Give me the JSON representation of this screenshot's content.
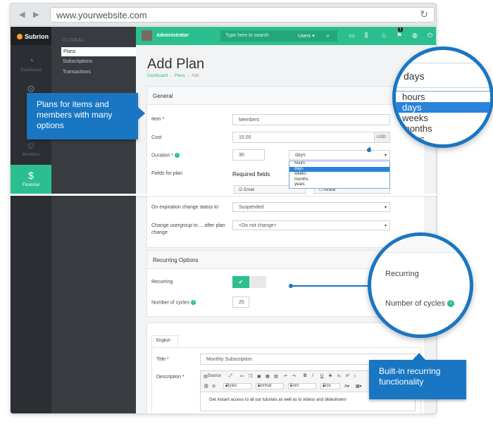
{
  "browser": {
    "url": "www.yourwebsite.com"
  },
  "app": {
    "logo": "Subrion",
    "sidebar": [
      {
        "label": "Dashboard",
        "icon": "dashboard-icon"
      },
      {
        "label": "",
        "icon": "gear-icon"
      },
      {
        "label": "",
        "icon": "content-icon"
      },
      {
        "label": "Members",
        "icon": "user-icon"
      },
      {
        "label": "Financial",
        "icon": "dollar-icon",
        "active": true
      }
    ],
    "subnav": {
      "group": "GLOBAL",
      "items": [
        "Plans",
        "Subscriptions",
        "Transactions"
      ],
      "active": "Plans"
    },
    "topbar": {
      "user": "Administrator",
      "search_placeholder": "Type here to search",
      "search_scope": "Users",
      "badge": "1"
    }
  },
  "page": {
    "title": "Add Plan",
    "breadcrumb": [
      "Dashboard",
      "Plans",
      "Add"
    ],
    "general": {
      "heading": "General",
      "item_label": "Item *",
      "item_value": "Members",
      "cost_label": "Cost",
      "cost_value": "15.00",
      "currency": "USD",
      "duration_label": "Duration *",
      "duration_value": "30",
      "duration_unit": "days",
      "duration_options": [
        "hours",
        "days",
        "weeks",
        "months",
        "years"
      ],
      "fields_label": "Fields for plan",
      "required_fields": "Required fields",
      "checkbox_email": "Email",
      "checkbox_avatar": "Avatar",
      "expiration_label": "On expiration change status to",
      "expiration_value": "Suspended",
      "usergroup_label": "Change usergroup to ... after plan change",
      "usergroup_value": "<Do not change>"
    },
    "recurring": {
      "heading": "Recurring Options",
      "recurring_label": "Recurring",
      "cycles_label": "Number of cycles",
      "cycles_value": "25"
    },
    "content": {
      "tab": "English",
      "title_label": "Title *",
      "title_value": "Monthly Subscription",
      "description_label": "Description *",
      "toolbar": {
        "source": "Source",
        "styles": "Styles",
        "format": "Normal",
        "font": "Font",
        "size": "Size"
      },
      "description_text": "Get instant access to all our tutorials as well as to videos and slideshows!"
    }
  },
  "callouts": {
    "plans": "Plans for items and members with many options",
    "recurring": "Built-in recurring functionality"
  },
  "colors": {
    "accent": "#2bbf8f",
    "callout": "#1976c2",
    "sidebar": "#2b2f33"
  }
}
